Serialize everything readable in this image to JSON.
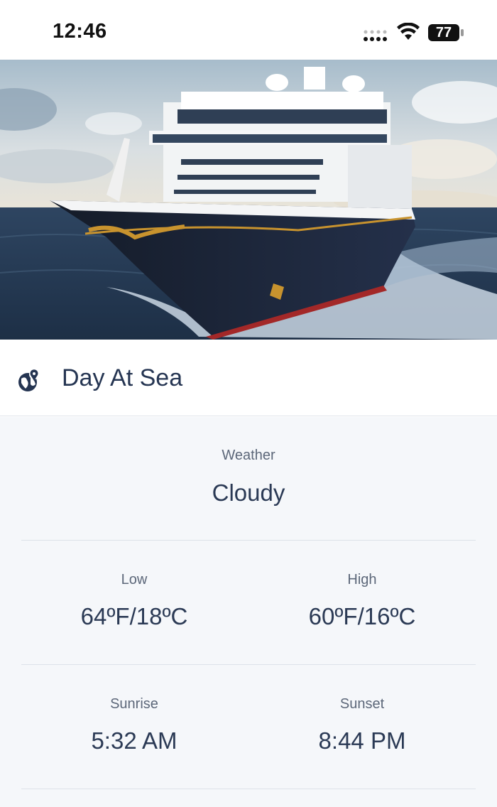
{
  "status_bar": {
    "time": "12:46",
    "battery_level": "77"
  },
  "hero": {
    "image_name": "cruise-ship-at-sea"
  },
  "header": {
    "title": "Day At Sea",
    "icon": "globe-pin-icon"
  },
  "weather": {
    "label": "Weather",
    "value": "Cloudy"
  },
  "temps": {
    "low_label": "Low",
    "low_value": "64ºF/18ºC",
    "high_label": "High",
    "high_value": "60ºF/16ºC"
  },
  "sun": {
    "sunrise_label": "Sunrise",
    "sunrise_value": "5:32 AM",
    "sunset_label": "Sunset",
    "sunset_value": "8:44 PM"
  },
  "colors": {
    "text_primary": "#2b3a55",
    "text_secondary": "#5c6779",
    "panel_bg": "#f5f7fa",
    "hull": "#1c2536",
    "hull_gold": "#c8932e"
  }
}
